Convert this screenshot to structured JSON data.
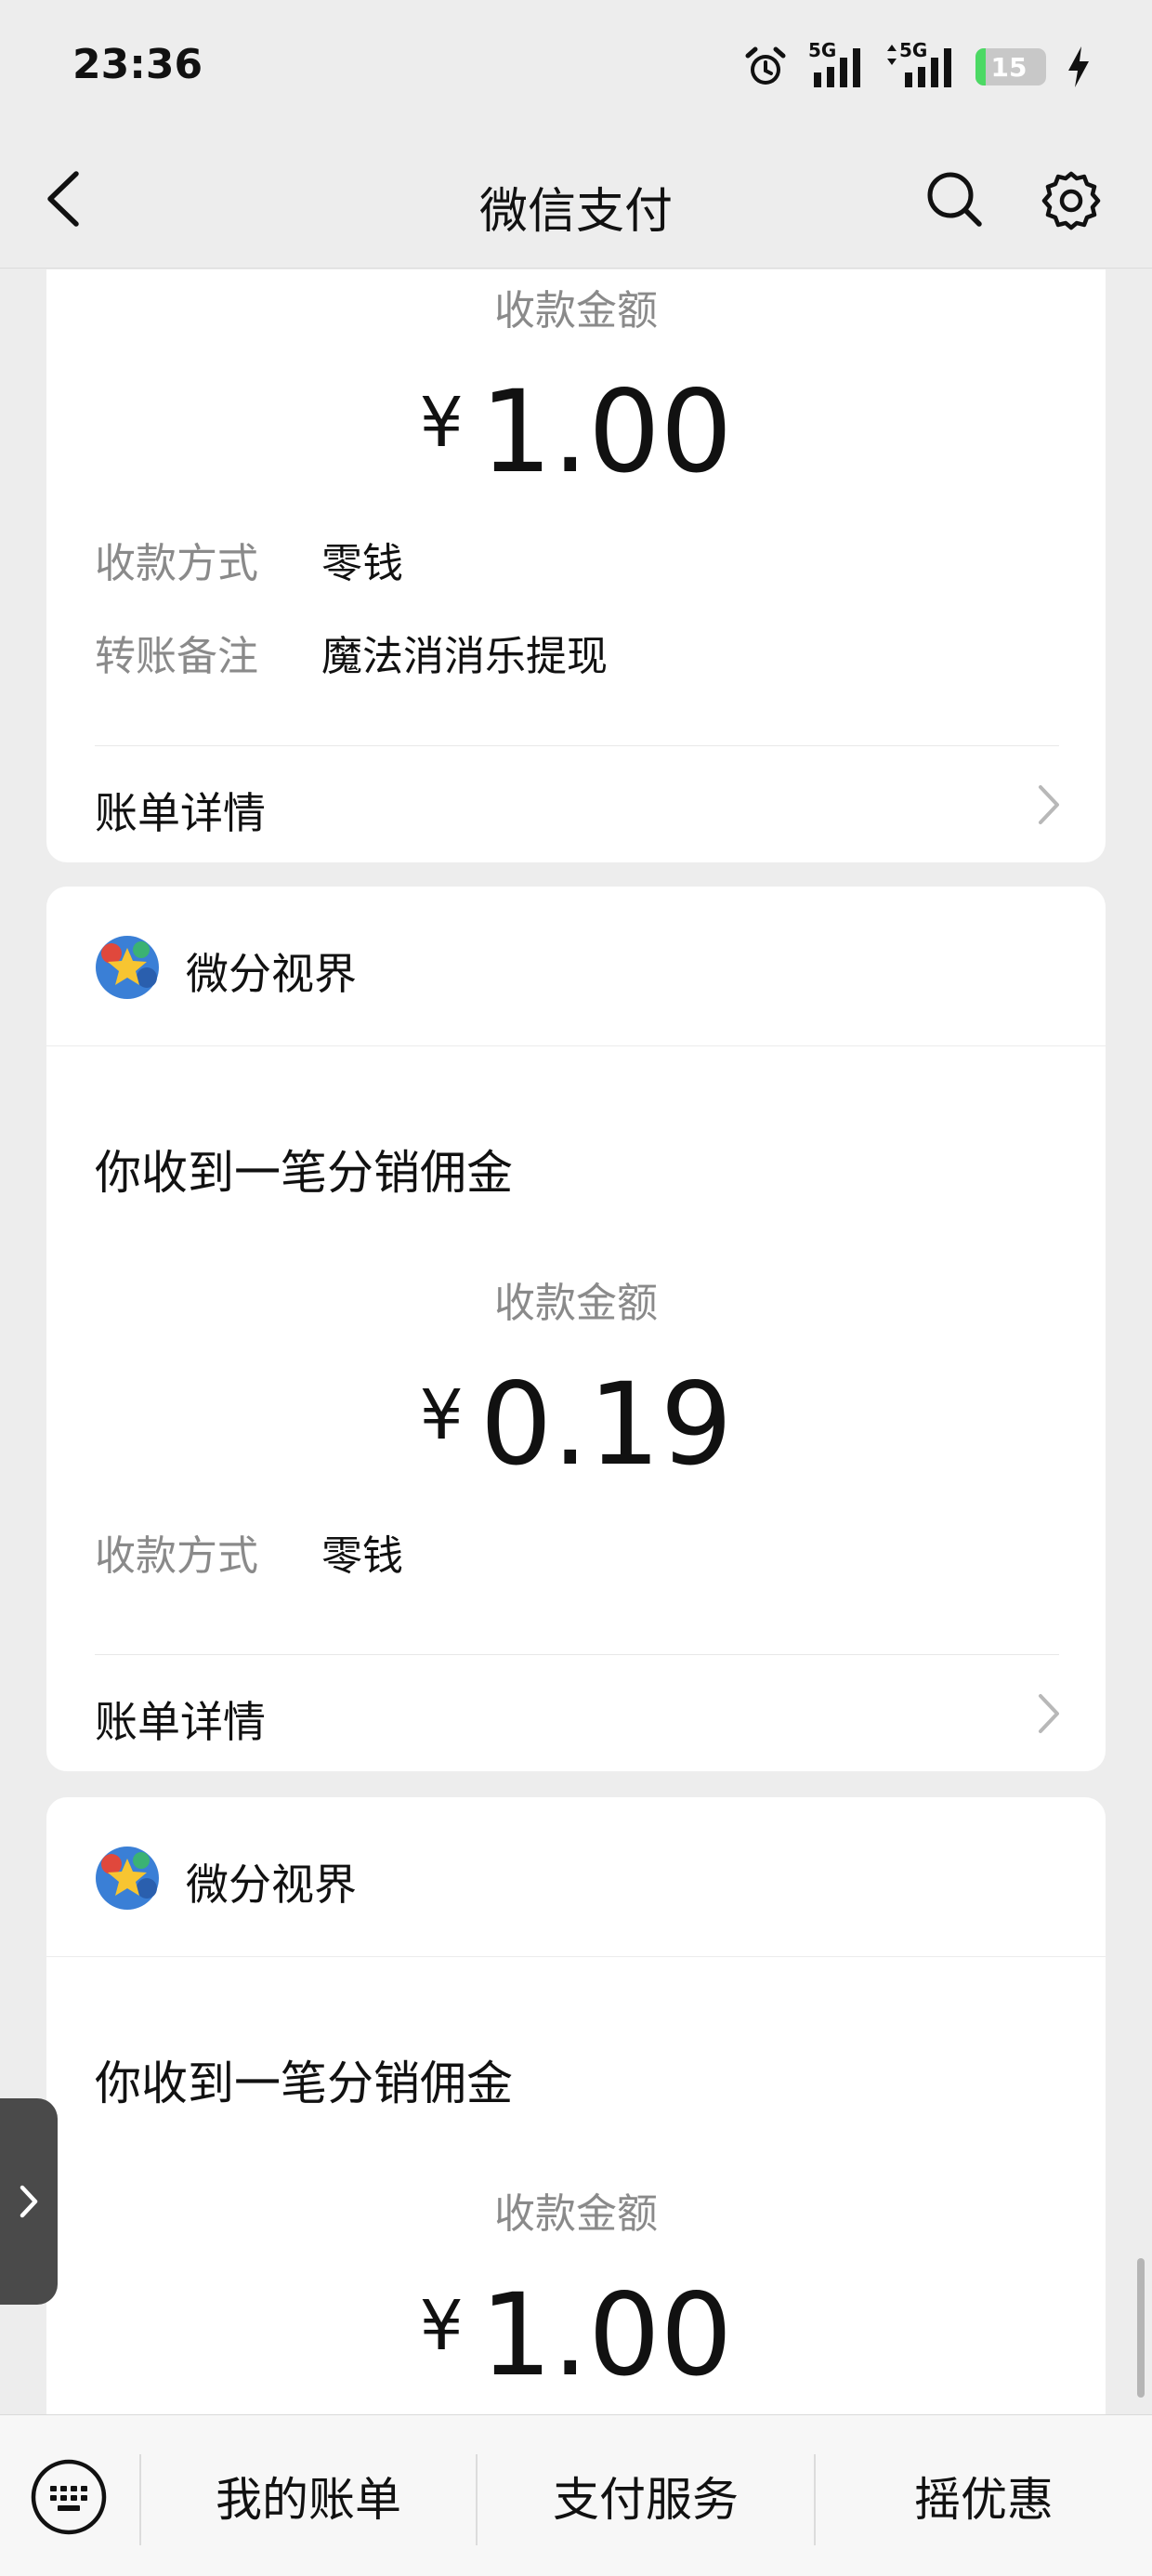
{
  "status_bar": {
    "time": "23:36",
    "network_1": "5G",
    "network_2": "5G",
    "battery_level": 15,
    "battery_text": "15"
  },
  "nav": {
    "title": "微信支付",
    "back_icon": "chevron-left-icon",
    "search_icon": "search-icon",
    "settings_icon": "gear-icon"
  },
  "cards": [
    {
      "amount_label": "收款金额",
      "currency": "¥",
      "amount": "1.00",
      "rows": [
        {
          "label": "收款方式",
          "value": "零钱"
        },
        {
          "label": "转账备注",
          "value": "魔法消消乐提现"
        }
      ],
      "detail_label": "账单详情"
    },
    {
      "app_name": "微分视界",
      "title": "你收到一笔分销佣金",
      "amount_label": "收款金额",
      "currency": "¥",
      "amount": "0.19",
      "rows": [
        {
          "label": "收款方式",
          "value": "零钱"
        }
      ],
      "detail_label": "账单详情"
    },
    {
      "app_name": "微分视界",
      "title": "你收到一笔分销佣金",
      "amount_label": "收款金额",
      "currency": "¥",
      "amount": "1.00"
    }
  ],
  "bottom_bar": {
    "items": [
      "我的账单",
      "支付服务",
      "摇优惠"
    ]
  },
  "colors": {
    "background": "#ededed",
    "card": "#ffffff",
    "label_gray": "#8a8a8a",
    "battery_green": "#4cd964"
  }
}
